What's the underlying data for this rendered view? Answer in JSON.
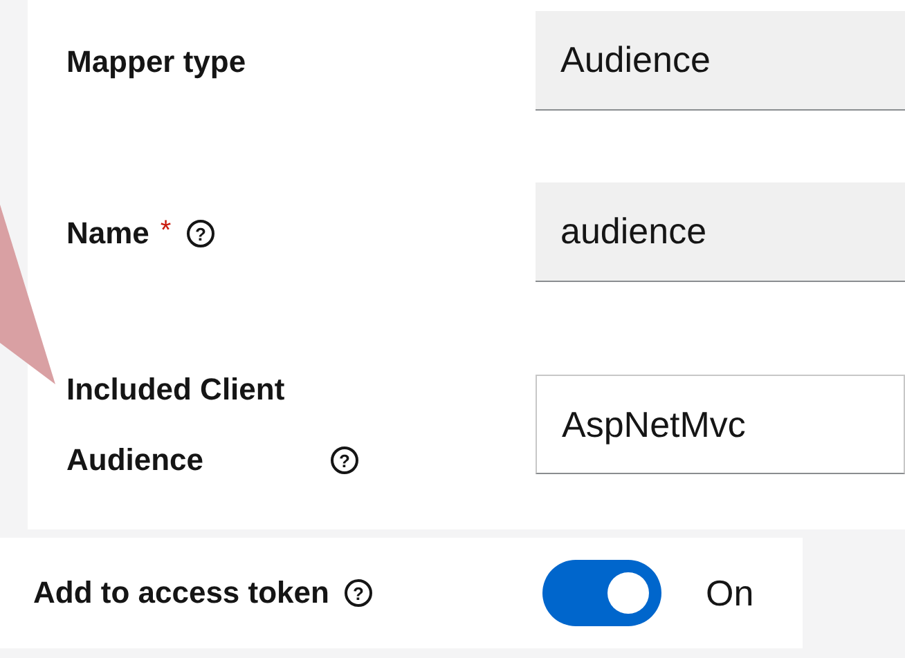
{
  "fields": [
    {
      "label": "Mapper type",
      "required": false,
      "help": false,
      "value": "Audience",
      "readonly": true
    },
    {
      "label": "Name",
      "required": true,
      "help": true,
      "value": "audience",
      "readonly": true
    },
    {
      "label": "Included Client Audience",
      "required": false,
      "help": true,
      "value": "AspNetMvc",
      "readonly": false
    }
  ],
  "toggle": {
    "label": "Add to access token",
    "help": true,
    "on": true,
    "state_text": "On"
  },
  "required_mark": "*",
  "help_mark": "?"
}
